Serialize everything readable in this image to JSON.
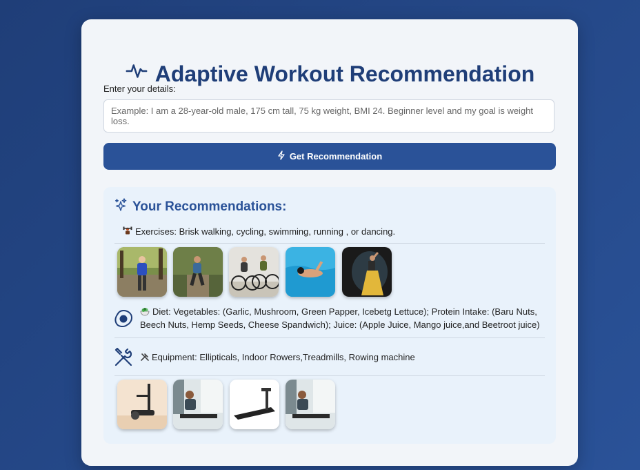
{
  "header": {
    "title": "Adaptive Workout Recommendation"
  },
  "form": {
    "label": "Enter your details:",
    "input_placeholder": "Example: I am a 28-year-old male, 175 cm tall, 75 kg weight, BMI 24. Beginner level and my goal is weight loss.",
    "input_value": "",
    "button_label": "Get Recommendation"
  },
  "recommendations": {
    "heading": "Your Recommendations:",
    "exercises_text": "Exercises: Brisk walking, cycling, swimming, running , or dancing.",
    "diet_text_line1": "Diet: Vegetables: (Garlic, Mushroom, Green Papper, Icebetg Lettuce); Protein Intake: (Baru Nuts,",
    "diet_text_line2": "Beech Nuts, Hemp Seeds, Cheese Spandwich); Juice: (Apple Juice, Mango juice,and Beetroot juice)",
    "equipment_text": "Equipment: Ellipticals, Indoor Rowers,Treadmills, Rowing machine"
  },
  "icons": {
    "title": "activity-pulse-icon",
    "button": "lightning-icon",
    "heading": "sparkles-icon",
    "exercises": "weightlifter-emoji-icon",
    "diet_side": "fried-egg-icon",
    "diet": "salad-emoji-icon",
    "equipment_side": "tools-icon",
    "equipment": "hammer-wrench-emoji-icon"
  },
  "colors": {
    "accent": "#2a5298",
    "title": "#1f3e78",
    "background": "#1f3e78"
  }
}
